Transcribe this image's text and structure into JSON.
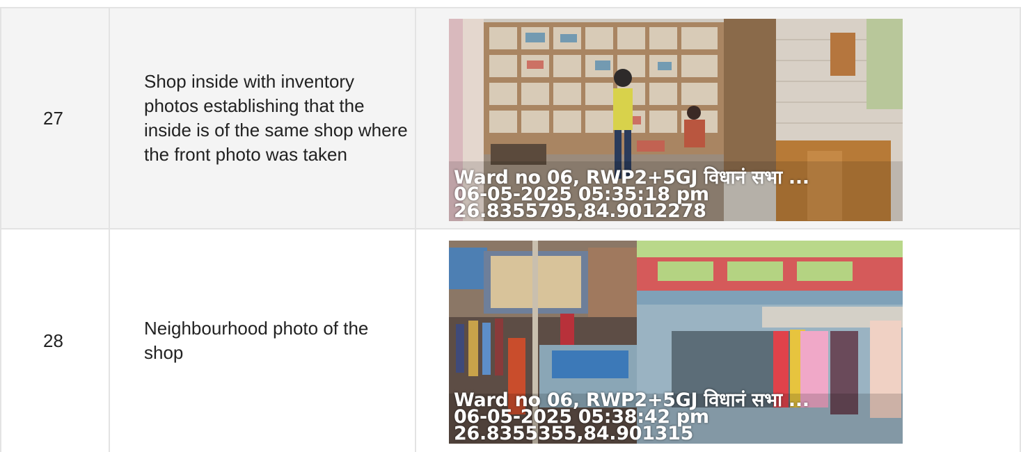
{
  "rows": [
    {
      "number": "27",
      "description": "Shop inside with inventory photos establishing that the inside is of the same shop where the front photo was taken",
      "photo": {
        "overlay": {
          "location": "Ward no 06, RWP2+5GJ विधानं सभा ...",
          "timestamp": "06-05-2025 05:35:18 pm",
          "coords": "26.8355795,84.9012278"
        }
      }
    },
    {
      "number": "28",
      "description": "Neighbourhood photo of the shop",
      "photo": {
        "overlay": {
          "location": "Ward no 06, RWP2+5GJ विधानं सभा ...",
          "timestamp": "06-05-2025 05:38:42 pm",
          "coords": "26.8355355,84.901315"
        }
      }
    }
  ]
}
